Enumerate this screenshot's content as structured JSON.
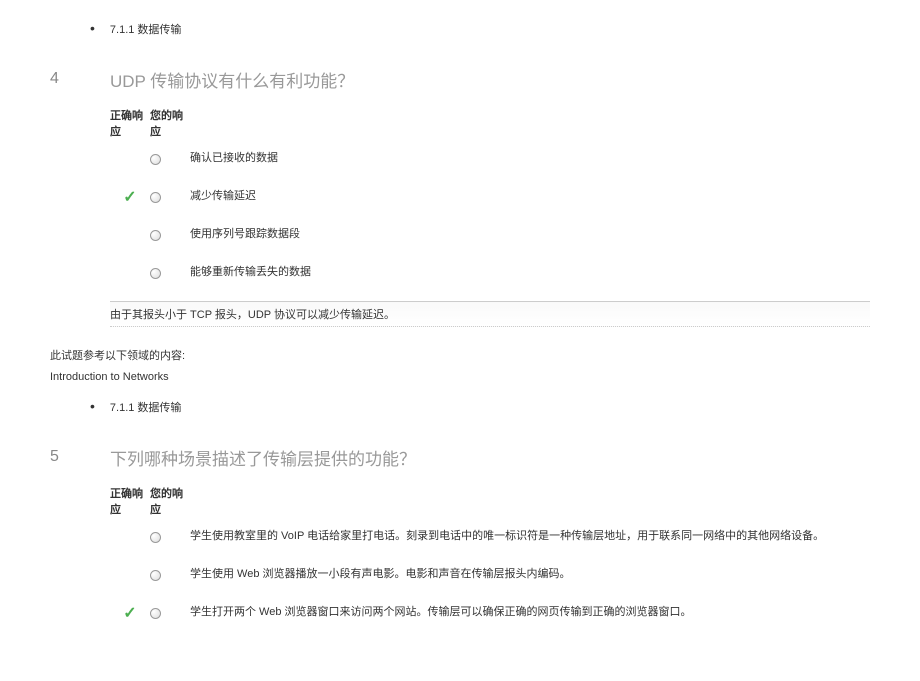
{
  "topic_ref_1": "7.1.1 数据传输",
  "q4": {
    "number": "4",
    "title": "UDP 传输协议有什么有利功能？",
    "header_correct": "正确响应",
    "header_your": "您的响应",
    "options": [
      {
        "text": "确认已接收的数据",
        "correct": false
      },
      {
        "text": "减少传输延迟",
        "correct": true
      },
      {
        "text": "使用序列号跟踪数据段",
        "correct": false
      },
      {
        "text": "能够重新传输丢失的数据",
        "correct": false
      }
    ],
    "explanation": "由于其报头小于 TCP 报头，UDP 协议可以减少传输延迟。"
  },
  "domain_ref_text": "此试题参考以下领域的内容:",
  "domain_name": "Introduction to Networks",
  "topic_ref_2": "7.1.1 数据传输",
  "q5": {
    "number": "5",
    "title": "下列哪种场景描述了传输层提供的功能？",
    "header_correct": "正确响应",
    "header_your": "您的响应",
    "options": [
      {
        "text": "学生使用教室里的 VoIP 电话给家里打电话。刻录到电话中的唯一标识符是一种传输层地址，用于联系同一网络中的其他网络设备。",
        "correct": false
      },
      {
        "text": "学生使用 Web 浏览器播放一小段有声电影。电影和声音在传输层报头内编码。",
        "correct": false
      },
      {
        "text": "学生打开两个 Web 浏览器窗口来访问两个网站。传输层可以确保正确的网页传输到正确的浏览器窗口。",
        "correct": true
      }
    ]
  }
}
